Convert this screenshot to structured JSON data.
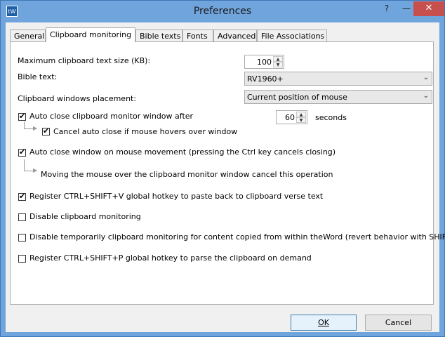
{
  "window": {
    "title": "Preferences",
    "app_icon_text": "tW",
    "help_glyph": "?",
    "min_glyph": "—",
    "close_glyph": "✕"
  },
  "tabs": [
    {
      "label": "General",
      "active": false
    },
    {
      "label": "Clipboard monitoring",
      "active": true
    },
    {
      "label": "Bible texts",
      "active": false
    },
    {
      "label": "Fonts",
      "active": false
    },
    {
      "label": "Advanced",
      "active": false
    },
    {
      "label": "File Associations",
      "active": false
    }
  ],
  "settings": {
    "max_size_label": "Maximum clipboard text size (KB):",
    "max_size_value": "100",
    "bible_text_label": "Bible text:",
    "bible_text_value": "RV1960+",
    "placement_label": "Clipboard windows placement:",
    "placement_value": "Current position of mouse",
    "auto_close_label": "Auto close clipboard monitor window after",
    "auto_close_checked": true,
    "auto_close_seconds": "60",
    "seconds_label": "seconds",
    "cancel_hover_label": "Cancel auto close if mouse hovers over window",
    "cancel_hover_checked": true,
    "auto_close_move_label": "Auto close window on mouse movement (pressing the Ctrl key cancels closing)",
    "auto_close_move_checked": true,
    "moving_note": "Moving the mouse over the clipboard monitor window cancel this operation",
    "register_paste_label": "Register CTRL+SHIFT+V global hotkey to paste back to clipboard verse text",
    "register_paste_checked": true,
    "disable_monitoring_label": "Disable clipboard monitoring",
    "disable_monitoring_checked": false,
    "disable_temp_label": "Disable temporarily clipboard monitoring for content copied from within theWord (revert behavior with SHIFT)",
    "disable_temp_checked": false,
    "register_parse_label": "Register CTRL+SHIFT+P global hotkey to parse the clipboard on demand",
    "register_parse_checked": false
  },
  "buttons": {
    "ok_label": "OK",
    "cancel_label": "Cancel"
  },
  "icons": {
    "check": "✔",
    "spin_up": "▲",
    "spin_down": "▼",
    "combo_arrow": "⌄",
    "connector_arrow": "▶"
  }
}
